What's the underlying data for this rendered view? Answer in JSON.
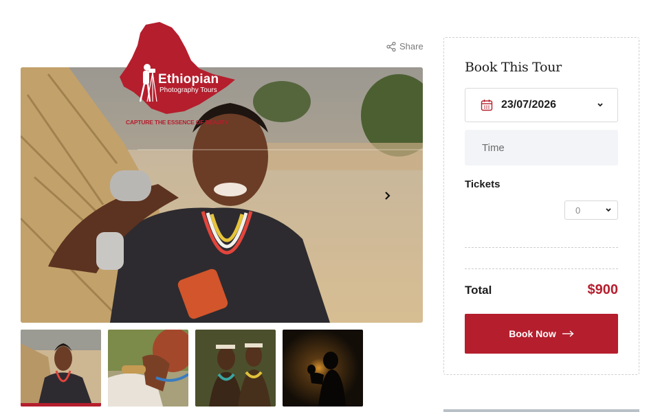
{
  "logo": {
    "title": "Ethiopian",
    "subtitle": "Photography Tours",
    "tagline": "CAPTURE THE ESSENCE OF BEAUTY",
    "brand_color": "#b51e2d"
  },
  "gallery": {
    "share_label": "Share",
    "share_icon": "share-icon",
    "next_icon": "chevron-right-icon",
    "active_thumb": 0,
    "thumbnails": [
      "thumb-smiling-girl",
      "thumb-woman-braided-hair",
      "thumb-two-warriors",
      "thumb-silhouette-sunset"
    ]
  },
  "booking": {
    "title": "Book This Tour",
    "date_value": "23/07/2026",
    "date_icon": "calendar-icon",
    "time_placeholder": "Time",
    "tickets_label": "Tickets",
    "tickets_value": "0",
    "total_label": "Total",
    "total_value": "$900",
    "book_label": "Book Now",
    "book_icon": "arrow-right-icon",
    "accent_color": "#b51e2d"
  }
}
